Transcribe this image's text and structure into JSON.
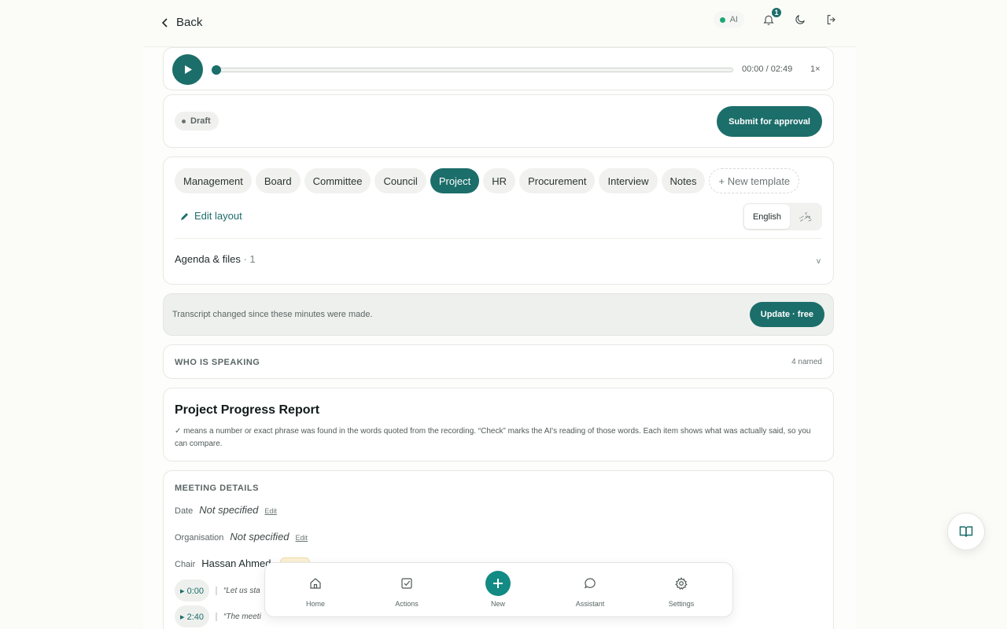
{
  "header": {
    "back_label": "Back",
    "ai_label": "AI",
    "notification_count": "1"
  },
  "player": {
    "time": "00:00 / 02:49",
    "speed": "1×",
    "progress": 0
  },
  "status": {
    "badge": "Draft",
    "submit_label": "Submit for approval"
  },
  "templates": {
    "chips": [
      "Management",
      "Board",
      "Committee",
      "Council",
      "Project",
      "HR",
      "Procurement",
      "Interview",
      "Notes"
    ],
    "active": "Project",
    "new_label": "+ New template",
    "edit_layout_label": "Edit layout",
    "lang_english": "English",
    "lang_other": "ޑިވެހި",
    "agenda_label": "Agenda & files",
    "agenda_count": "· 1",
    "chevron": "v"
  },
  "notice": {
    "text": "Transcript changed since these minutes were made.",
    "button_label": "Update · free"
  },
  "speakers": {
    "title": "WHO IS SPEAKING",
    "count": "4 named"
  },
  "report": {
    "title": "Project Progress Report",
    "note": "✓ means a number or exact phrase was found in the words quoted from the recording. “Check” marks the AI's reading of those words. Each item shows what was actually said, so you can compare."
  },
  "details": {
    "title": "MEETING DETAILS",
    "date_label": "Date",
    "date_value": "Not specified",
    "org_label": "Organisation",
    "org_value": "Not specified",
    "chair_label": "Chair",
    "chair_value": "Hassan Ahmed",
    "edit_label": "Edit",
    "timestamps": [
      {
        "time": "▸ 0:00",
        "quote": "“Let us sta"
      },
      {
        "time": "▸ 2:40",
        "quote": "“The meeti"
      }
    ]
  },
  "nav": {
    "home": "Home",
    "actions": "Actions",
    "new": "New",
    "assistant": "Assistant",
    "settings": "Settings"
  },
  "colors": {
    "accent": "#1c6e6a",
    "new_button": "#138a84",
    "ai_dot": "#1ea67a"
  }
}
